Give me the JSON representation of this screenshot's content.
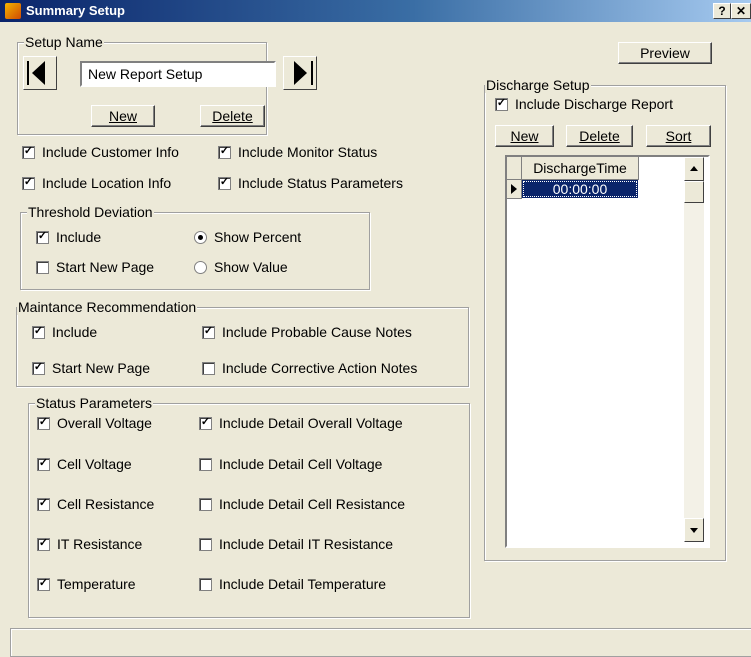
{
  "window": {
    "title": "Summary Setup",
    "help_label": "?",
    "close_label": "✕"
  },
  "preview_label": "Preview",
  "setup_name": {
    "title": "Setup Name",
    "value": "New Report Setup",
    "new_label": "New",
    "delete_label": "Delete"
  },
  "top_checks": {
    "customer_info": "Include Customer Info",
    "monitor_status": "Include Monitor Status",
    "location_info": "Include Location Info",
    "status_parameters": "Include Status Parameters"
  },
  "threshold": {
    "title": "Threshold Deviation",
    "include": "Include",
    "show_percent": "Show Percent",
    "start_new_page": "Start New Page",
    "show_value": "Show Value"
  },
  "maintenance": {
    "title": "Maintance Recommendation",
    "include": "Include",
    "probable_cause": "Include Probable Cause Notes",
    "start_new_page": "Start New Page",
    "corrective_action": "Include Corrective Action Notes"
  },
  "status_params": {
    "title": "Status Parameters",
    "overall_voltage": "Overall Voltage",
    "detail_overall_voltage": "Include Detail Overall Voltage",
    "cell_voltage": "Cell Voltage",
    "detail_cell_voltage": "Include Detail Cell Voltage",
    "cell_resistance": "Cell Resistance",
    "detail_cell_resistance": "Include Detail Cell Resistance",
    "it_resistance": "IT Resistance",
    "detail_it_resistance": "Include Detail IT Resistance",
    "temperature": "Temperature",
    "detail_temperature": "Include Detail Temperature"
  },
  "discharge": {
    "title": "Discharge Setup",
    "include_report": "Include  Discharge Report",
    "new_label": "New",
    "delete_label": "Delete",
    "sort_label": "Sort",
    "column_header": "DischargeTime",
    "row_value": "00:00:00"
  },
  "colors": {
    "face": "#ece9d8",
    "selection": "#0a246a",
    "title_start": "#0a246a",
    "title_end": "#a6caf0"
  }
}
